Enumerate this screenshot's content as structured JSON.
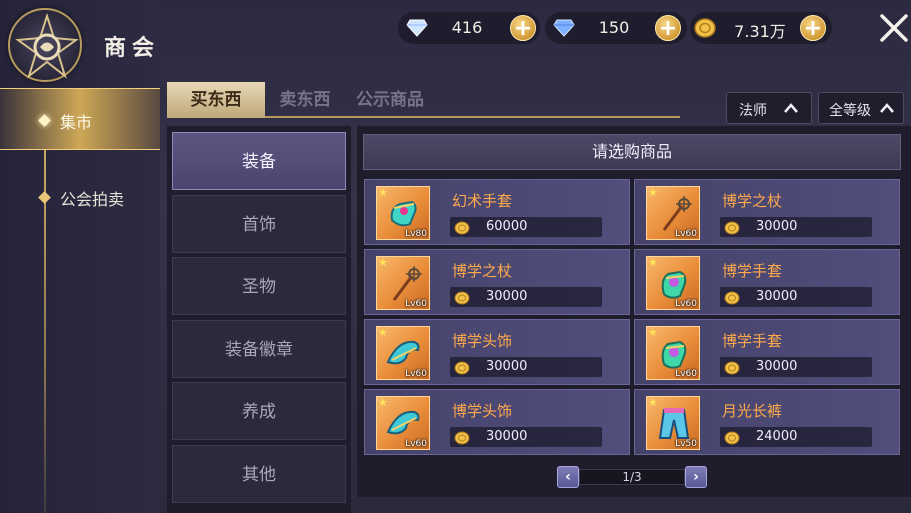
{
  "header": {
    "title": "商会",
    "close_icon": "close-icon"
  },
  "currencies": [
    {
      "icon": "diamond-icon",
      "value": "416"
    },
    {
      "icon": "crystal-icon",
      "value": "150"
    },
    {
      "icon": "gold-coin-icon",
      "value": "7.31万"
    }
  ],
  "sidebar": {
    "items": [
      {
        "label": "集市",
        "active": true
      },
      {
        "label": "公会拍卖",
        "active": false
      }
    ]
  },
  "tabs": [
    {
      "label": "买东西",
      "active": true
    },
    {
      "label": "卖东西",
      "active": false
    },
    {
      "label": "公示商品",
      "active": false
    }
  ],
  "filters": {
    "class_label": "法师",
    "level_label": "全等级"
  },
  "categories": [
    {
      "label": "装备",
      "active": true
    },
    {
      "label": "首饰",
      "active": false
    },
    {
      "label": "圣物",
      "active": false
    },
    {
      "label": "装备徽章",
      "active": false
    },
    {
      "label": "养成",
      "active": false
    },
    {
      "label": "其他",
      "active": false
    }
  ],
  "goods": {
    "header": "请选购商品",
    "items": [
      {
        "name": "幻术手套",
        "price": "60000",
        "level": "Lv80",
        "icon": "gloves-icon"
      },
      {
        "name": "博学之杖",
        "price": "30000",
        "level": "Lv60",
        "icon": "staff-icon"
      },
      {
        "name": "博学之杖",
        "price": "30000",
        "level": "Lv60",
        "icon": "staff-icon"
      },
      {
        "name": "博学手套",
        "price": "30000",
        "level": "Lv60",
        "icon": "gloves-icon"
      },
      {
        "name": "博学头饰",
        "price": "30000",
        "level": "Lv60",
        "icon": "hat-icon"
      },
      {
        "name": "博学手套",
        "price": "30000",
        "level": "Lv60",
        "icon": "gloves-icon"
      },
      {
        "name": "博学头饰",
        "price": "30000",
        "level": "Lv60",
        "icon": "hat-icon"
      },
      {
        "name": "月光长裤",
        "price": "24000",
        "level": "Lv50",
        "icon": "pants-icon"
      }
    ]
  },
  "pager": {
    "text": "1/3",
    "prev": "‹",
    "next": "›"
  },
  "colors": {
    "accent_gold": "#d9b46a",
    "item_name": "#ffa94a",
    "active_category": "#524e78"
  }
}
